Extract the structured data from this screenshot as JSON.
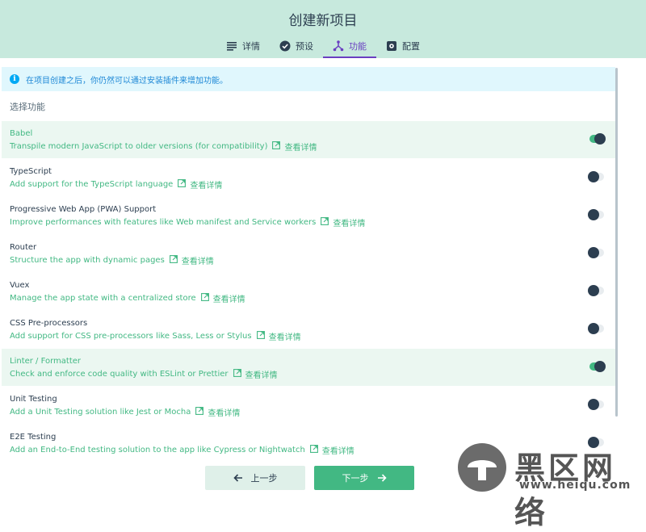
{
  "header": {
    "title": "创建新项目",
    "tabs": [
      {
        "label": "详情",
        "icon": "list-icon"
      },
      {
        "label": "预设",
        "icon": "check-circle-icon"
      },
      {
        "label": "功能",
        "icon": "branch-icon",
        "active": true
      },
      {
        "label": "配置",
        "icon": "settings-box-icon"
      }
    ]
  },
  "info": {
    "text": "在项目创建之后，你仍然可以通过安装插件来增加功能。"
  },
  "section_label": "选择功能",
  "link_label": "查看详情",
  "features": [
    {
      "name": "Babel",
      "desc": "Transpile modern JavaScript to older versions (for compatibility)",
      "enabled": true
    },
    {
      "name": "TypeScript",
      "desc": "Add support for the TypeScript language",
      "enabled": false
    },
    {
      "name": "Progressive Web App (PWA) Support",
      "desc": "Improve performances with features like Web manifest and Service workers",
      "enabled": false
    },
    {
      "name": "Router",
      "desc": "Structure the app with dynamic pages",
      "enabled": false
    },
    {
      "name": "Vuex",
      "desc": "Manage the app state with a centralized store",
      "enabled": false
    },
    {
      "name": "CSS Pre-processors",
      "desc": "Add support for CSS pre-processors like Sass, Less or Stylus",
      "enabled": false
    },
    {
      "name": "Linter / Formatter",
      "desc": "Check and enforce code quality with ESLint or Prettier",
      "enabled": true
    },
    {
      "name": "Unit Testing",
      "desc": "Add a Unit Testing solution like Jest or Mocha",
      "enabled": false
    },
    {
      "name": "E2E Testing",
      "desc": "Add an End-to-End testing solution to the app like Cypress or Nightwatch",
      "enabled": false
    }
  ],
  "buttons": {
    "prev": "上一步",
    "next": "下一步"
  },
  "watermark": {
    "text": "黑区网络",
    "url": "www.heiqu.com"
  },
  "colors": {
    "accent": "#42b883",
    "header_bg": "#c7e9dd",
    "active_tab": "#6a3fc1",
    "info_bg": "#e0f7fd"
  }
}
